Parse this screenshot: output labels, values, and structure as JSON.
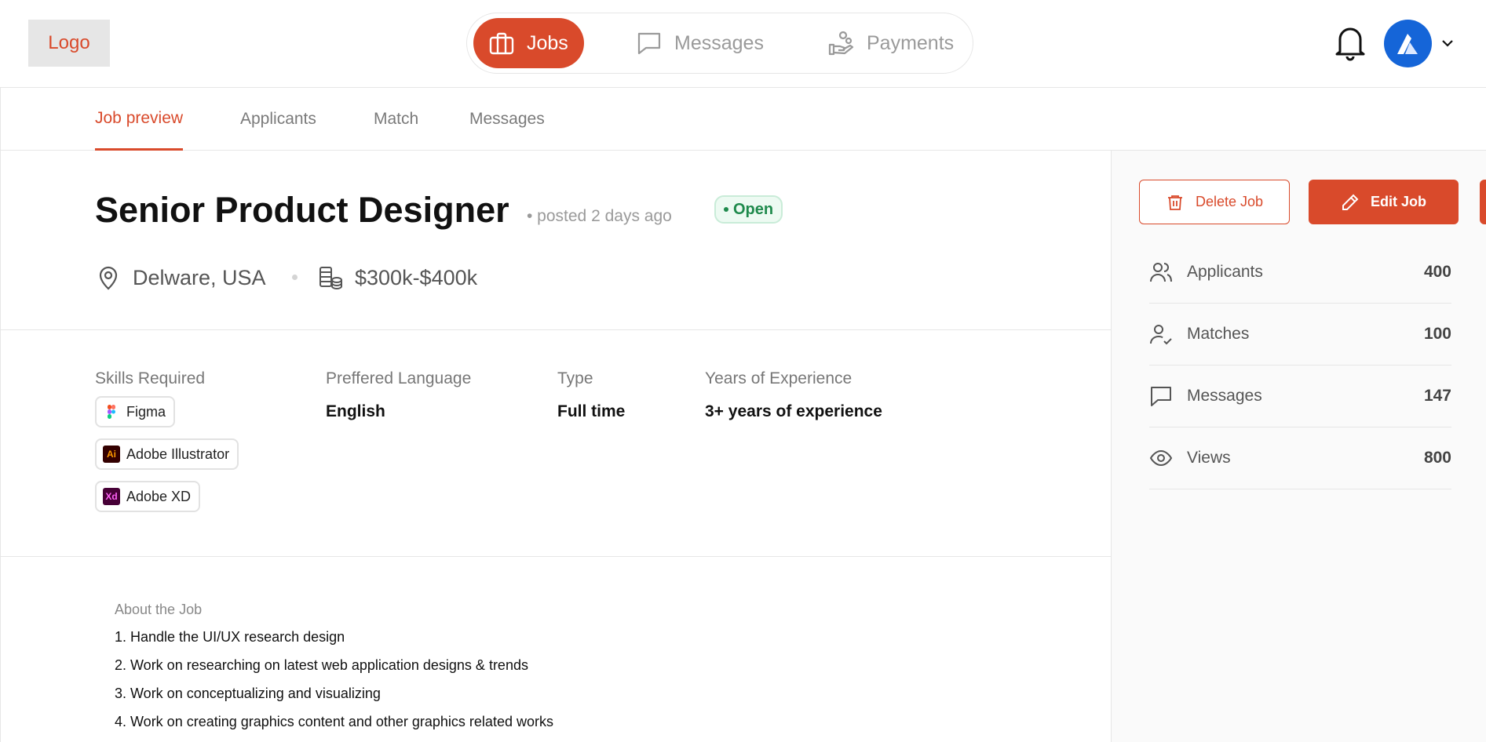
{
  "brand": {
    "logo": "Logo",
    "accent": "#d94a2b"
  },
  "nav": {
    "jobs": "Jobs",
    "messages": "Messages",
    "payments": "Payments"
  },
  "tabs": [
    "Job preview",
    "Applicants",
    "Match",
    "Messages"
  ],
  "job": {
    "title": "Senior Product Designer",
    "posted": "• posted 2 days ago",
    "status": "Open",
    "location": "Delware, USA",
    "salary": "$300k-$400k"
  },
  "details": {
    "skills_label": "Skills Required",
    "skills": [
      "Figma",
      "Adobe Illustrator",
      "Adobe XD"
    ],
    "skill_badges": {
      "illustrator": "Ai",
      "xd": "Xd"
    },
    "language_label": "Preffered Language",
    "language": "English",
    "type_label": "Type",
    "type": "Full time",
    "experience_label": "Years of Experience",
    "experience": "3+ years of experience"
  },
  "about": {
    "title": "About the Job",
    "lines": [
      "1. Handle the UI/UX research design",
      "2. Work on researching on latest web application designs & trends",
      "3. Work on conceptualizing and visualizing",
      "4. Work on creating graphics content and other graphics related works"
    ]
  },
  "actions": {
    "delete": "Delete Job",
    "edit": "Edit Job"
  },
  "stats": [
    {
      "label": "Applicants",
      "value": "400",
      "icon": "users-icon"
    },
    {
      "label": "Matches",
      "value": "100",
      "icon": "user-check-icon"
    },
    {
      "label": "Messages",
      "value": "147",
      "icon": "message-icon"
    },
    {
      "label": "Views",
      "value": "800",
      "icon": "eye-icon"
    }
  ]
}
